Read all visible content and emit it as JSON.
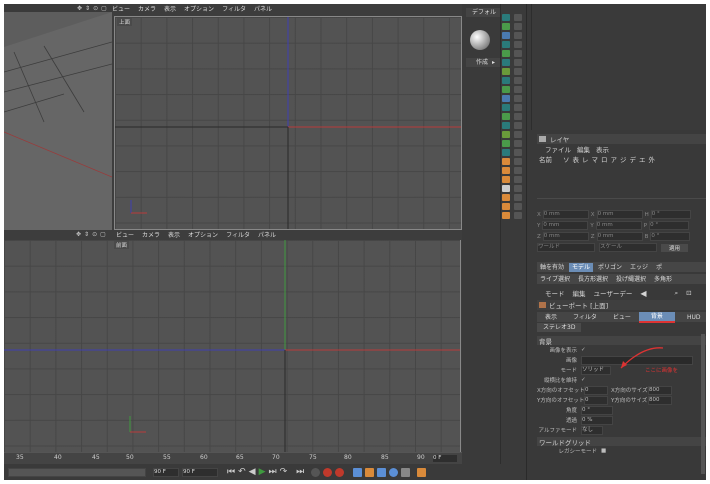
{
  "viewport_menu": [
    "ビュー",
    "カメラ",
    "表示",
    "オプション",
    "フィルタ",
    "パネル"
  ],
  "viewport_icons": [
    "move-view-icon",
    "pan-icon",
    "zoom-icon",
    "maximize-icon"
  ],
  "top_view_label": "上面",
  "front_view_label": "前面",
  "object_manager": {
    "title": "デフォル",
    "menu": "作成"
  },
  "layer_manager": {
    "title": "レイヤ",
    "menu": [
      "ファイル",
      "編集",
      "表示"
    ],
    "name_col": "名前",
    "col_letters": [
      "ソ",
      "表",
      "レ",
      "マ",
      "ロ",
      "ア",
      "ジ",
      "デ",
      "エ",
      "外"
    ]
  },
  "coordinates": {
    "rows": [
      {
        "axis": "X",
        "v1": "0 mm",
        "axis2": "X",
        "v2": "0 mm",
        "axis3": "H",
        "v3": "0 °"
      },
      {
        "axis": "Y",
        "v1": "0 mm",
        "axis2": "Y",
        "v2": "0 mm",
        "axis3": "P",
        "v3": "0 °"
      },
      {
        "axis": "Z",
        "v1": "0 mm",
        "axis2": "Z",
        "v2": "0 mm",
        "axis3": "B",
        "v3": "0 °"
      }
    ],
    "dropdown1": "ワールド",
    "dropdown2": "スケール",
    "apply": "適用"
  },
  "mode_tabs": [
    "軸を有効",
    "モデル",
    "ポリゴン",
    "エッジ",
    "ポ"
  ],
  "selection_tabs": [
    "ライブ選択",
    "長方形選択",
    "投げ縄選択",
    "多角形"
  ],
  "attr_menu": [
    "モード",
    "編集",
    "ユーザーデー"
  ],
  "attr_title": "ビューポート [上面]",
  "attr_tabs": [
    "表示",
    "フィルタ",
    "ビュー",
    "背景",
    "HUD"
  ],
  "attr_tab_active": "背景",
  "stereo_tab": "ステレオ3D",
  "background": {
    "section": "背景",
    "show_image": "画像を表示",
    "show_image_check": "✓",
    "image_label": "画像",
    "mode_label": "モード",
    "mode_value": "ソリッド",
    "keep_ratio": "縦横比を維持",
    "keep_ratio_check": "✓",
    "x_offset_label": "X方向のオフセット",
    "x_offset": "0",
    "x_size_label": "X方向のサイズ",
    "x_size": "800",
    "y_offset_label": "Y方向のオフセット",
    "y_offset": "0",
    "y_size_label": "Y方向のサイズ",
    "y_size": "800",
    "rotation_label": "角度",
    "rotation": "0 °",
    "transparency_label": "透過",
    "transparency": "0 %",
    "alpha_label": "アルファモード",
    "alpha": "なし",
    "annotation": "ここに画像を"
  },
  "world_grid": {
    "title": "ワールドグリッド",
    "legacy": "レガシーモード",
    "legacy_check": "■"
  },
  "timeline_ticks": [
    "35",
    "40",
    "45",
    "50",
    "55",
    "60",
    "65",
    "70",
    "75",
    "80",
    "85",
    "90"
  ],
  "frame_field": "0 F",
  "frame_min": "90 F",
  "frame_max": "90 F",
  "transport_icons": [
    "go-start-icon",
    "prev-key-icon",
    "play-back-icon",
    "play-icon",
    "next-key-icon",
    "go-end-icon"
  ],
  "accent": "#6b8db6",
  "axis_red": "#b83b3b",
  "axis_green": "#3f9a3f",
  "axis_blue": "#3f3fb0"
}
